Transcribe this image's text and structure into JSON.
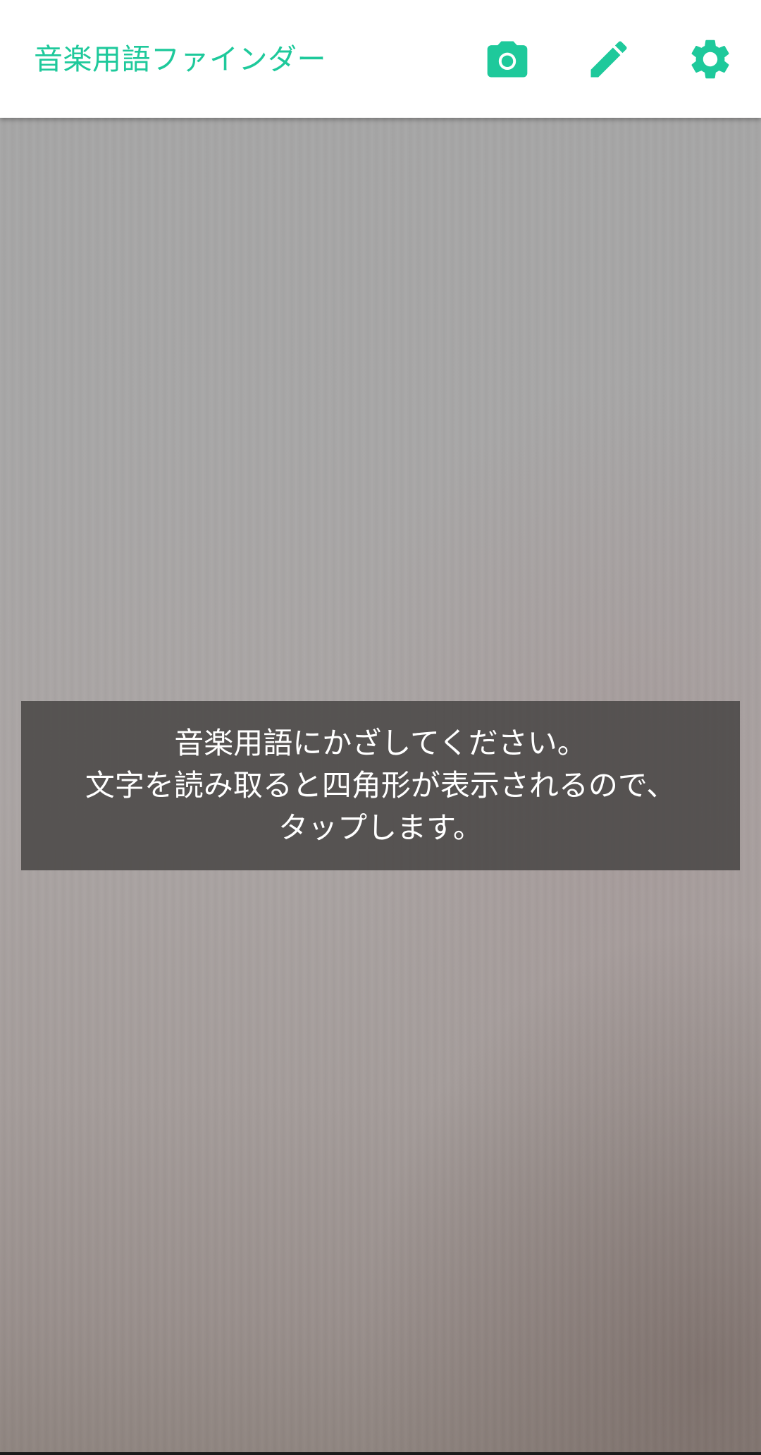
{
  "app_bar": {
    "title": "音楽用語ファインダー",
    "actions": [
      {
        "name": "camera",
        "icon": "camera-icon"
      },
      {
        "name": "edit",
        "icon": "pencil-icon"
      },
      {
        "name": "settings",
        "icon": "gear-icon"
      }
    ]
  },
  "hint": {
    "lines": [
      "音楽用語にかざしてください。",
      "文字を読み取ると四角形が表示されるので、",
      "タップします。"
    ]
  },
  "colors": {
    "accent": "#1ec99b",
    "app_bar_bg": "#ffffff",
    "hint_bg": "#484645",
    "hint_text": "#ffffff"
  }
}
